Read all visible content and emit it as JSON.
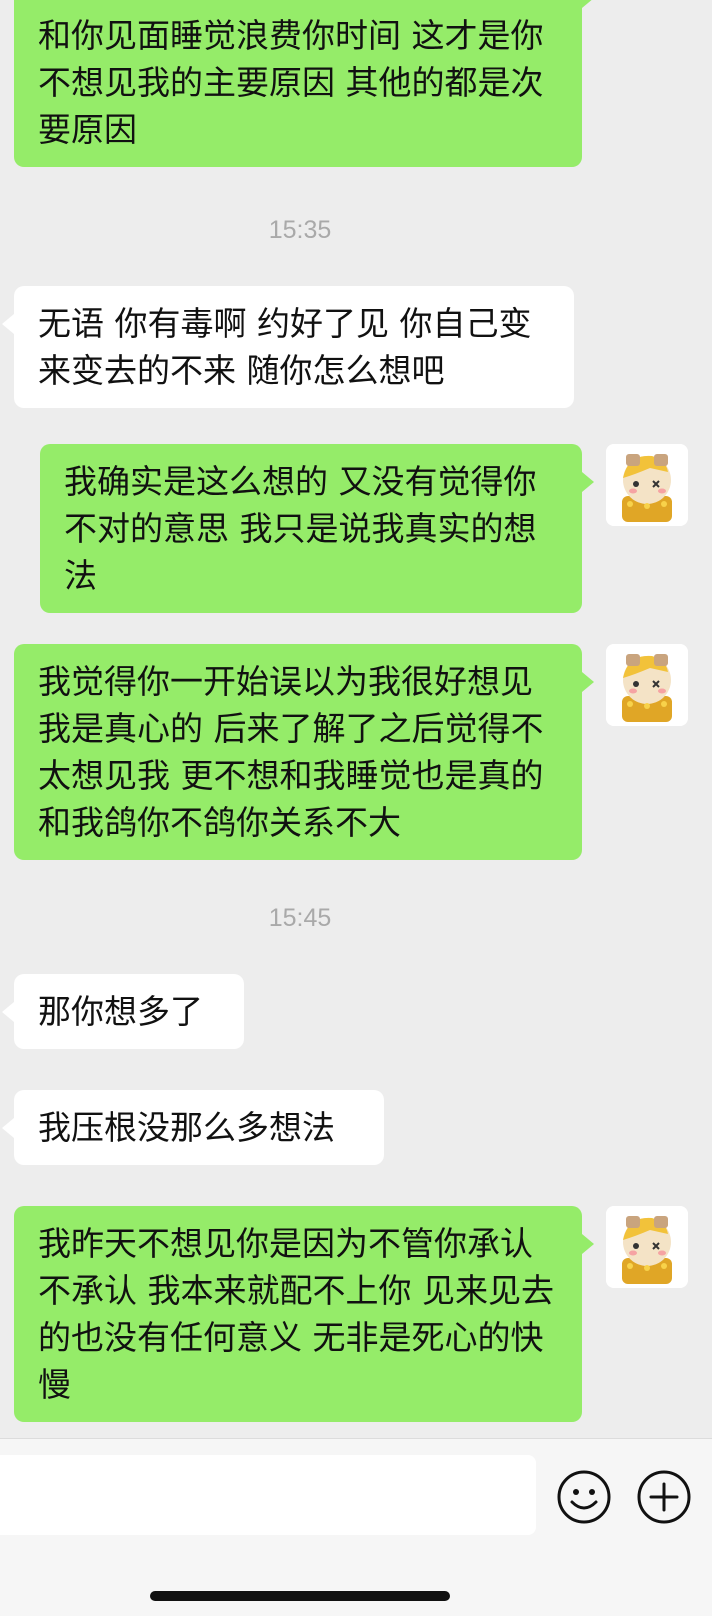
{
  "messages": [
    {
      "text": "和你见面睡觉浪费你时间 这才是你不想见我的主要原因 其他的都是次要原因"
    },
    {
      "text": "无语 你有毒啊 约好了见 你自己变来变去的不来 随你怎么想吧"
    },
    {
      "text": "我确实是这么想的 又没有觉得你不对的意思 我只是说我真实的想法"
    },
    {
      "text": "我觉得你一开始误以为我很好想见我是真心的 后来了解了之后觉得不太想见我 更不想和我睡觉也是真的 和我鸽你不鸽你关系不大"
    },
    {
      "text": "那你想多了"
    },
    {
      "text": "我压根没那么多想法"
    },
    {
      "text": "我昨天不想见你是因为不管你承认不承认 我本来就配不上你 见来见去的也没有任何意义 无非是死心的快慢"
    }
  ],
  "timestamps": [
    "15:35",
    "15:45"
  ],
  "input": {
    "placeholder": ""
  },
  "icons": {
    "emoji": "emoji-icon",
    "plus": "plus-icon",
    "avatar": "avatar-image"
  },
  "colors": {
    "sent_bubble": "#95ec69",
    "received_bubble": "#ffffff",
    "background": "#ededed"
  }
}
